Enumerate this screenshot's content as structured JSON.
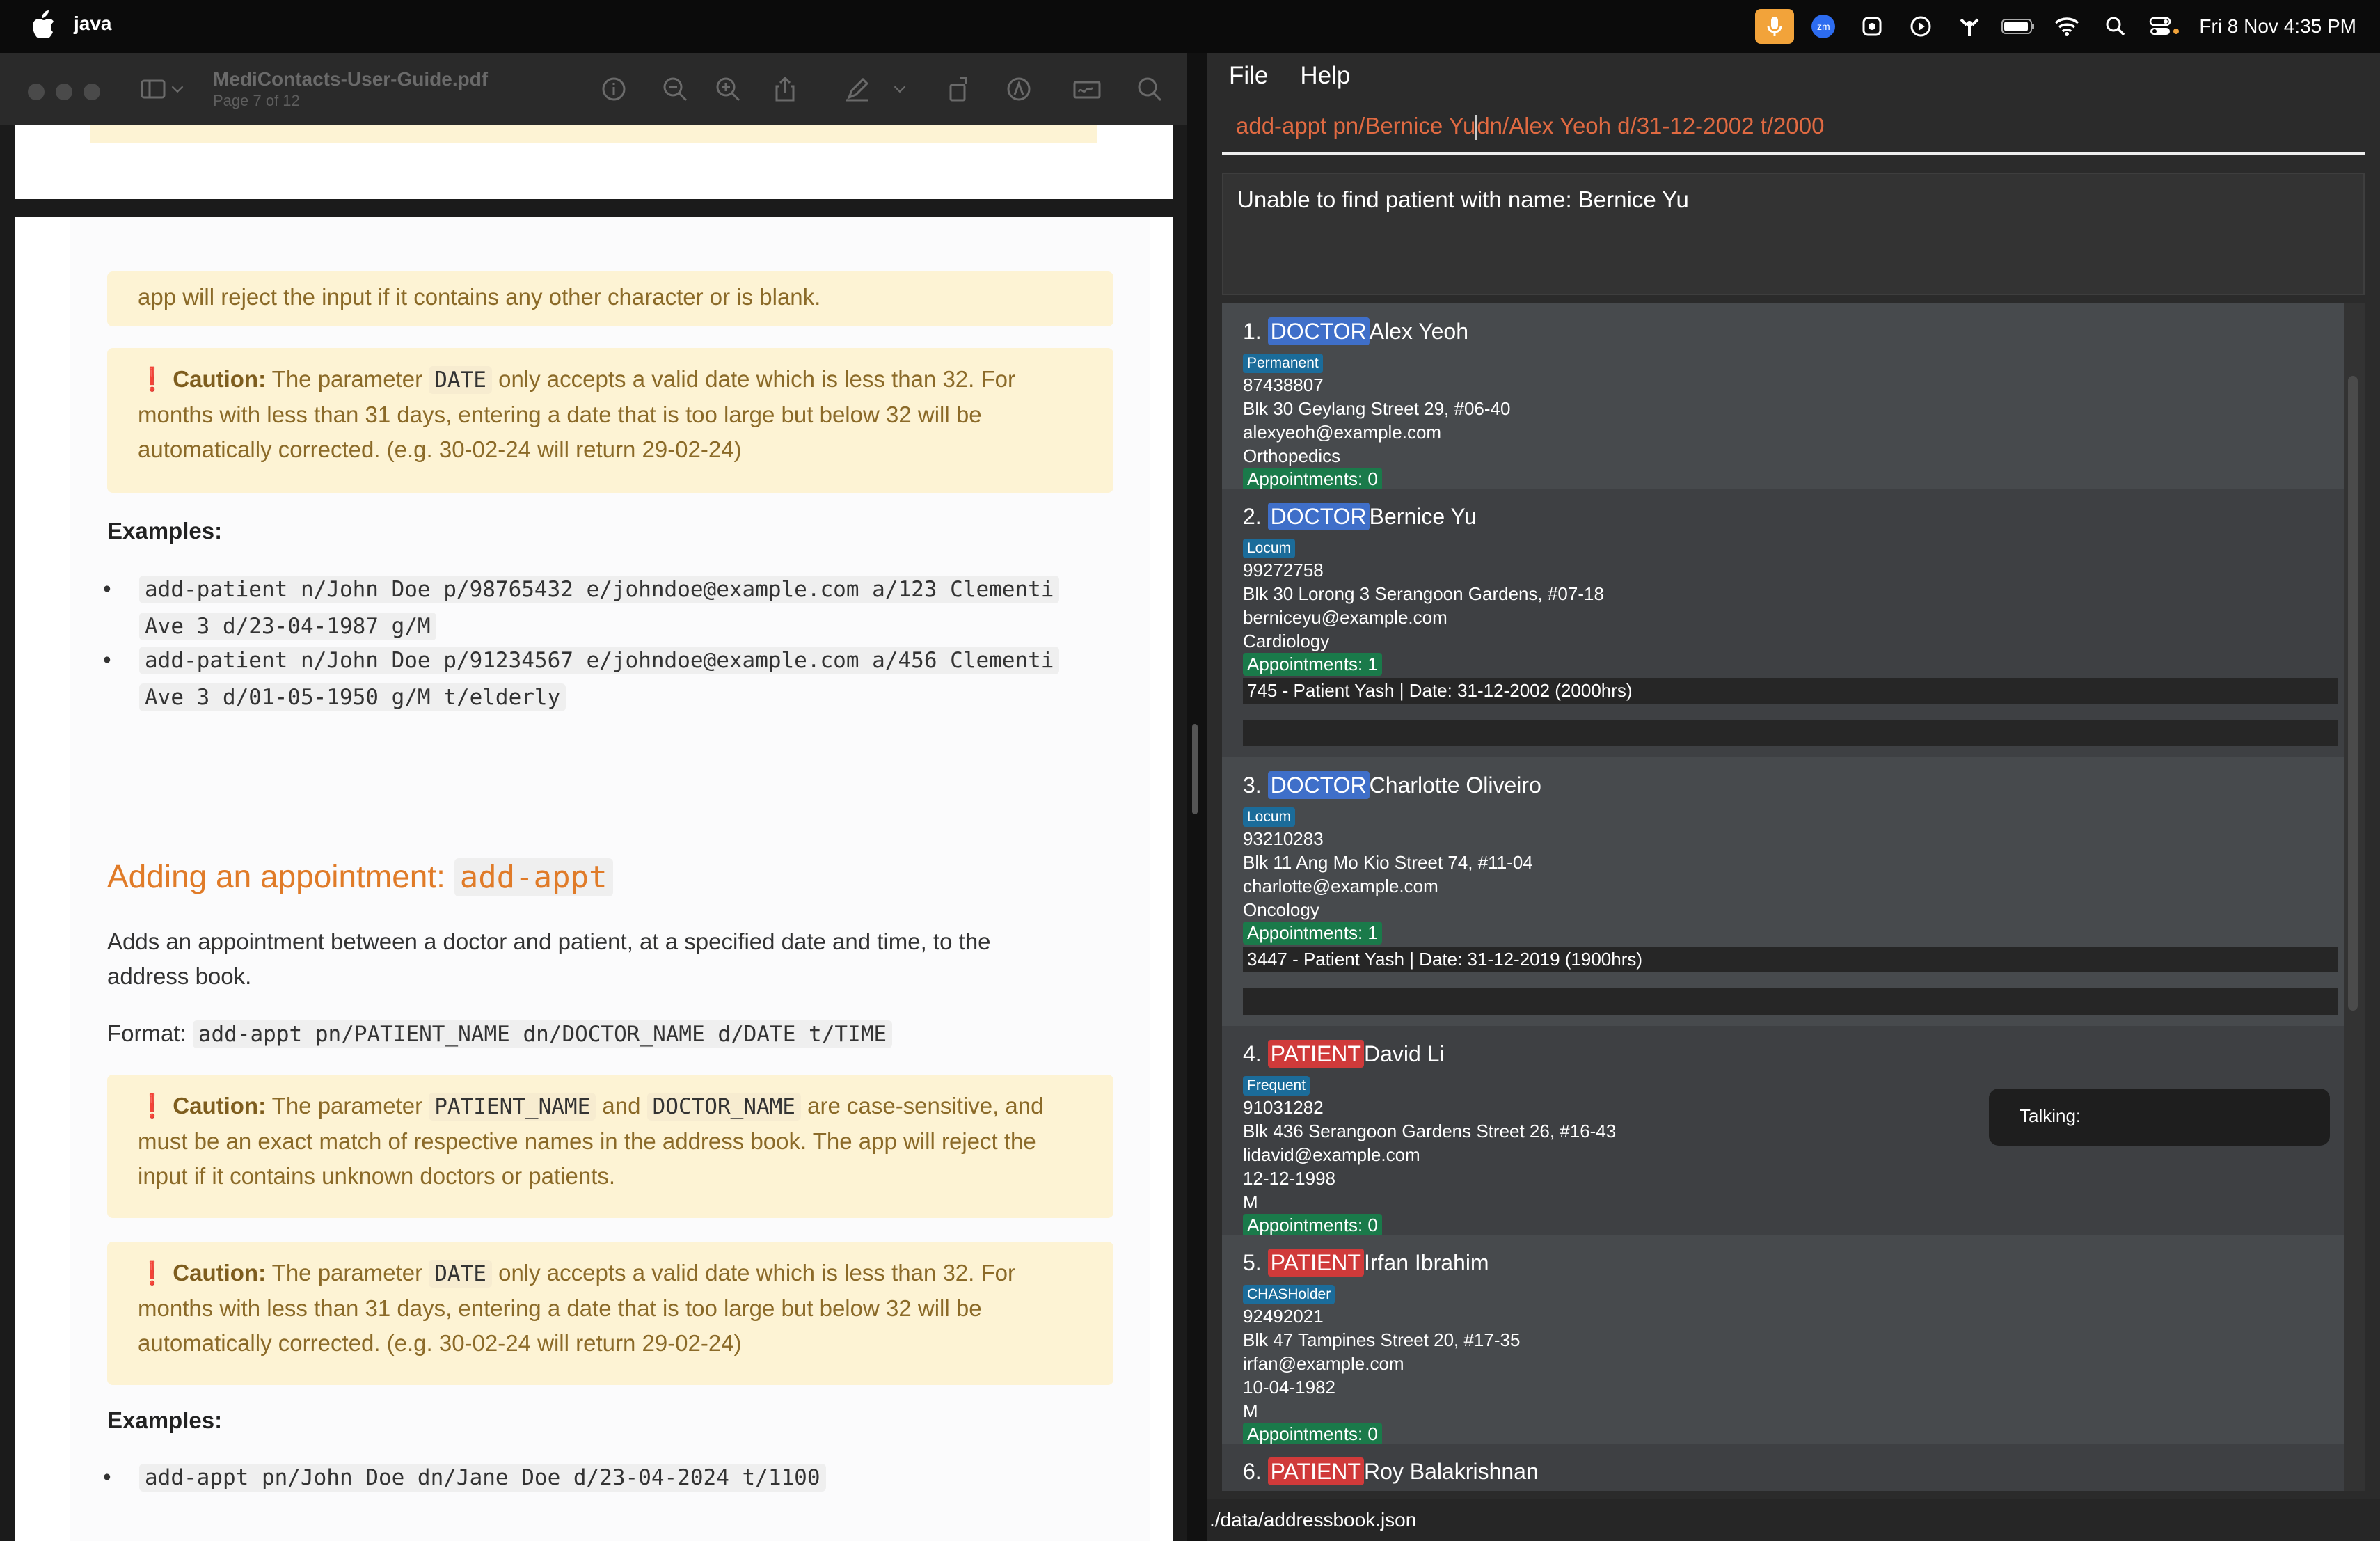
{
  "menubar": {
    "app_name": "java",
    "clock": "Fri 8 Nov  4:35 PM",
    "zoom_label": "zm"
  },
  "preview": {
    "title": "MediContacts-User-Guide.pdf",
    "subtitle": "Page 7 of 12",
    "para_reject": "app will reject the input if it contains any other character or is blank.",
    "caution_label": "Caution:",
    "caution_date_a": "The parameter",
    "code_date": "DATE",
    "caution_date_b": "only accepts a valid date which is less than 32. For",
    "caution_date_c": "months with less than 31 days, entering a date that is too large but below 32 will be",
    "caution_date_d": "automatically corrected. (e.g. 30-02-24 will return 29-02-24)",
    "examples_label": "Examples:",
    "ex1_a": "add-patient n/John Doe p/98765432 e/johndoe@example.com a/123 Clementi",
    "ex1_b": "Ave 3 d/23-04-1987 g/M",
    "ex2_a": "add-patient n/John Doe p/91234567 e/johndoe@example.com a/456 Clementi",
    "ex2_b": "Ave 3 d/01-05-1950 g/M t/elderly",
    "heading_text": "Adding an appointment:",
    "heading_code": "add-appt",
    "desc_a": "Adds an appointment between a doctor and patient, at a specified date and time, to the",
    "desc_b": "address book.",
    "format_label": "Format:",
    "format_code": "add-appt pn/PATIENT_NAME dn/DOCTOR_NAME d/DATE t/TIME",
    "caution_names_a": "The parameter",
    "code_patient_name": "PATIENT_NAME",
    "caution_and": "and",
    "code_doctor_name": "DOCTOR_NAME",
    "caution_names_b": "are case-sensitive, and",
    "caution_names_c": "must be an exact match of respective names in the address book. The app will reject the",
    "caution_names_d": "input if it contains unknown doctors or patients.",
    "ex3": "add-appt pn/John Doe dn/Jane Doe d/23-04-2024 t/1100"
  },
  "app": {
    "menu_file": "File",
    "menu_help": "Help",
    "command_before": "add-appt pn/Bernice Yu",
    "command_after": "dn/Alex Yeoh d/31-12-2002 t/2000",
    "result": "Unable to find patient with name: Bernice Yu",
    "talking": "Talking:",
    "status_path": "./data/addressbook.json",
    "cards": [
      {
        "num": "1.",
        "role": "DOCTOR",
        "name": "Alex Yeoh",
        "tag": "Permanent",
        "phone": "87438807",
        "address": "Blk 30 Geylang Street 29, #06-40",
        "email": "alexyeoh@example.com",
        "extra": "Orthopedics",
        "appts": "Appointments: 0"
      },
      {
        "num": "2.",
        "role": "DOCTOR",
        "name": "Bernice Yu",
        "tag": "Locum",
        "phone": "99272758",
        "address": "Blk 30 Lorong 3 Serangoon Gardens, #07-18",
        "email": "berniceyu@example.com",
        "extra": "Cardiology",
        "appts": "Appointments: 1",
        "appt_line": "745 - Patient Yash | Date: 31-12-2002 (2000hrs)"
      },
      {
        "num": "3.",
        "role": "DOCTOR",
        "name": "Charlotte Oliveiro",
        "tag": "Locum",
        "phone": "93210283",
        "address": "Blk 11 Ang Mo Kio Street 74, #11-04",
        "email": "charlotte@example.com",
        "extra": "Oncology",
        "appts": "Appointments: 1",
        "appt_line": "3447 - Patient Yash | Date: 31-12-2019 (1900hrs)"
      },
      {
        "num": "4.",
        "role": "PATIENT",
        "name": "David Li",
        "tag": "Frequent",
        "phone": "91031282",
        "address": "Blk 436 Serangoon Gardens Street 26, #16-43",
        "email": "lidavid@example.com",
        "extra": "12-12-1998",
        "extra2": "M",
        "appts": "Appointments: 0"
      },
      {
        "num": "5.",
        "role": "PATIENT",
        "name": "Irfan Ibrahim",
        "tag": "CHASHolder",
        "phone": "92492021",
        "address": "Blk 47 Tampines Street 20, #17-35",
        "email": "irfan@example.com",
        "extra": "10-04-1982",
        "extra2": "M",
        "appts": "Appointments: 0"
      },
      {
        "num": "6.",
        "role": "PATIENT",
        "name": "Roy Balakrishnan"
      }
    ]
  },
  "colors": {
    "doctor": "#3f6fc9",
    "patient": "#d03a3a",
    "appointments": "#1a7a4a",
    "heading": "#e07b28",
    "command": "#e06a42"
  },
  "icons": [
    "apple-icon",
    "microphone-icon",
    "zoom-icon",
    "vpn-icon",
    "play-icon",
    "airdrop-icon",
    "battery-icon",
    "wifi-icon",
    "spotlight-icon",
    "control-center-icon",
    "sidebar-icon",
    "info-icon",
    "zoom-out-icon",
    "zoom-in-icon",
    "share-icon",
    "markup-pen-icon",
    "rotate-icon",
    "annotate-icon",
    "signature-icon",
    "search-icon"
  ]
}
